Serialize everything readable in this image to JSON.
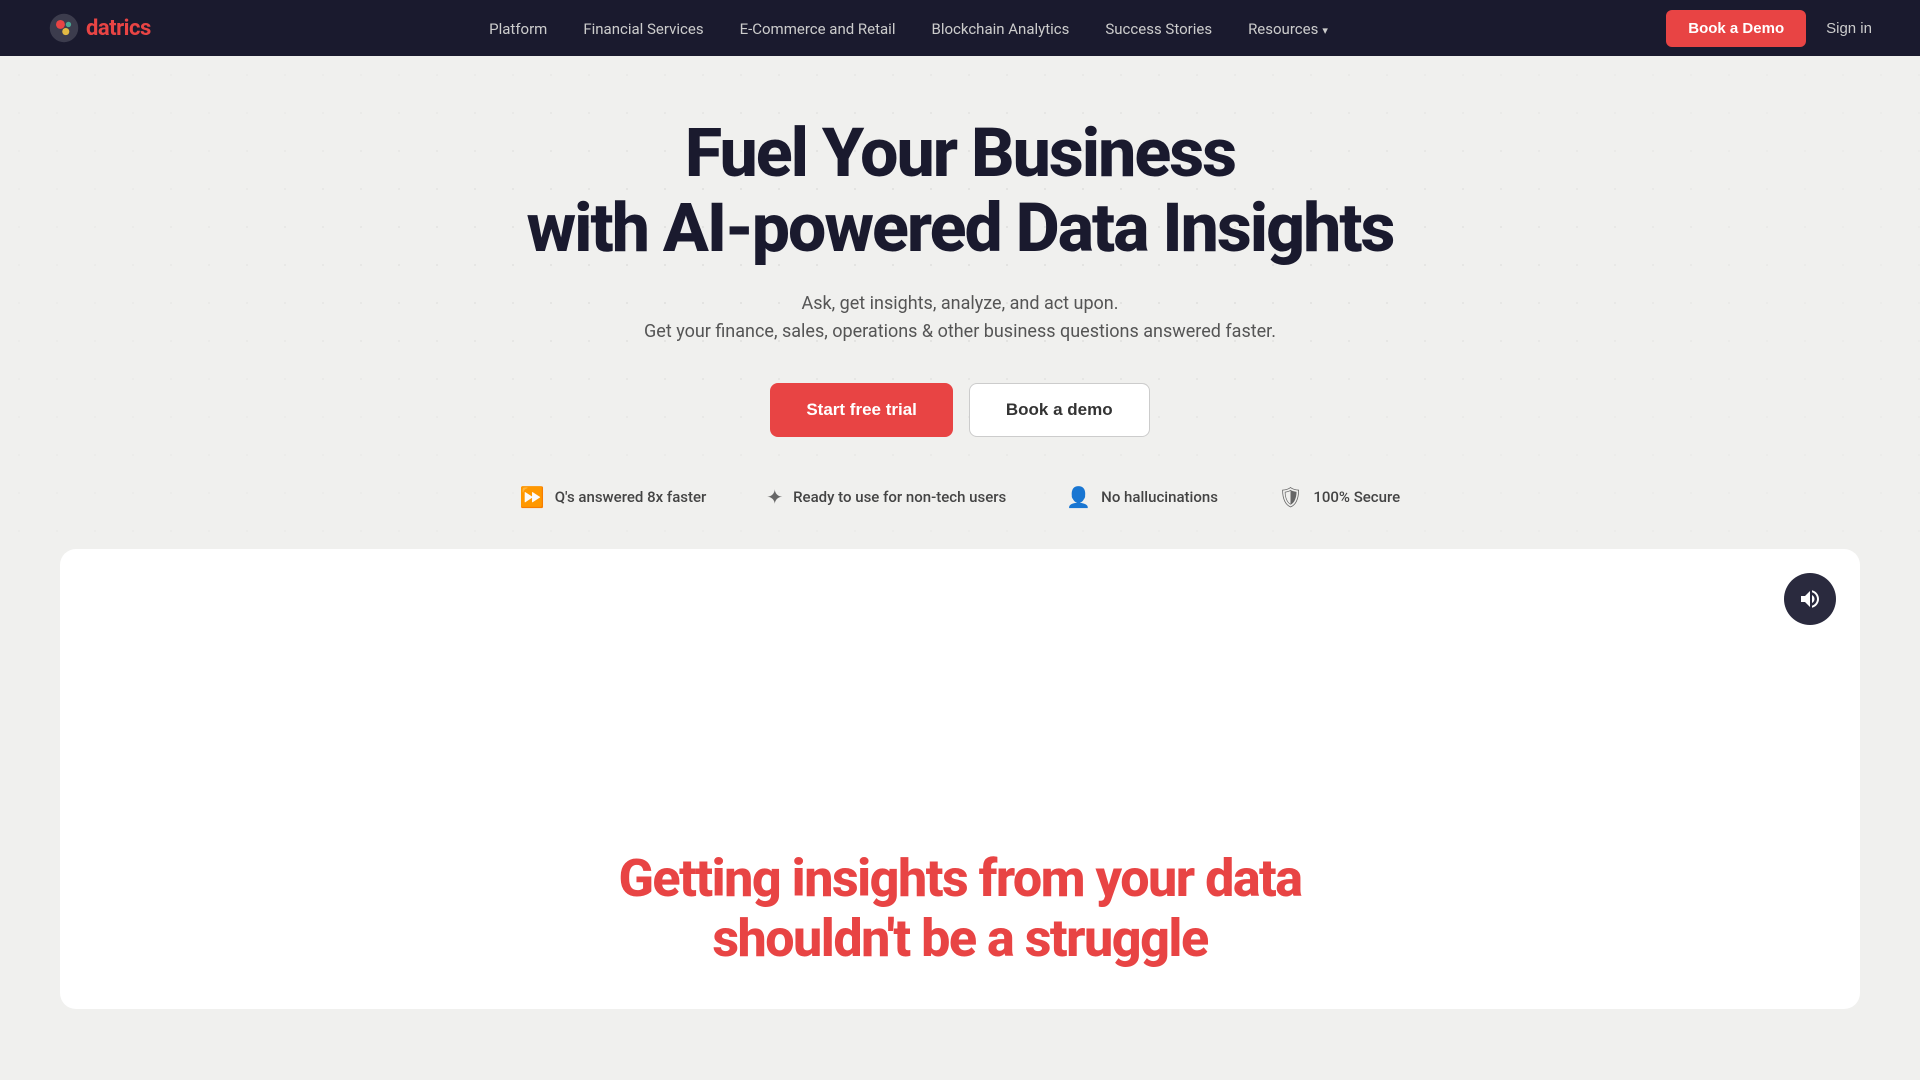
{
  "nav": {
    "logo_text_d": "d",
    "logo_text_rest": "atrics",
    "links": [
      {
        "label": "Platform",
        "id": "nav-platform"
      },
      {
        "label": "Financial Services",
        "id": "nav-financial"
      },
      {
        "label": "E-Commerce and Retail",
        "id": "nav-ecommerce"
      },
      {
        "label": "Blockchain Analytics",
        "id": "nav-blockchain"
      },
      {
        "label": "Success Stories",
        "id": "nav-success"
      },
      {
        "label": "Resources",
        "id": "nav-resources",
        "has_dropdown": true
      }
    ],
    "book_demo_label": "Book a Demo",
    "sign_in_label": "Sign in"
  },
  "hero": {
    "title_line1": "Fuel Your Business",
    "title_line2": "with AI-powered Data Insights",
    "subtitle_line1": "Ask, get insights, analyze, and act upon.",
    "subtitle_line2": "Get your finance, sales, operations & other business questions answered faster.",
    "cta_primary": "Start free trial",
    "cta_secondary": "Book a demo",
    "features": [
      {
        "icon": "⏩",
        "label": "Q's answered 8x faster",
        "id": "feature-speed"
      },
      {
        "icon": "✦",
        "label": "Ready to use for non-tech users",
        "id": "feature-nonttech"
      },
      {
        "icon": "👤",
        "label": "No hallucinations",
        "id": "feature-nohalluc"
      },
      {
        "icon": "🛡",
        "label": "100% Secure",
        "id": "feature-secure"
      }
    ]
  },
  "card_section": {
    "volume_label": "volume",
    "title_part1": "Getting insights from your data",
    "title_part2": "shouldn't be a struggle"
  },
  "colors": {
    "accent": "#e84444",
    "dark_bg": "#1a1a2e",
    "light_bg": "#f0f0ee",
    "white": "#ffffff"
  }
}
